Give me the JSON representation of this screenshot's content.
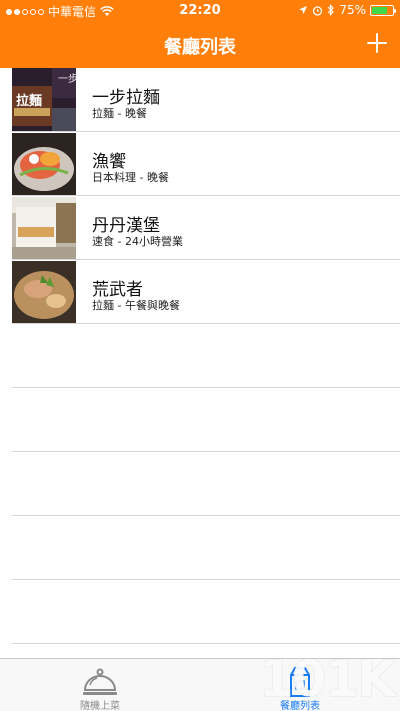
{
  "status_bar": {
    "carrier": "中華電信",
    "time": "22:20",
    "battery": "75%",
    "battery_level": 0.75,
    "signal_bars_filled": 2,
    "signal_bars_total": 5
  },
  "nav": {
    "title": "餐廳列表",
    "add_icon": "plus-icon"
  },
  "restaurants": [
    {
      "name": "一步拉麵",
      "meta": "拉麵 - 晚餐",
      "thumb_text": "拉麵"
    },
    {
      "name": "漁饗",
      "meta": "日本料理 - 晚餐"
    },
    {
      "name": "丹丹漢堡",
      "meta": "速食 - 24小時營業"
    },
    {
      "name": "荒武者",
      "meta": "拉麵 - 午餐與晚餐"
    }
  ],
  "tabs": [
    {
      "label": "隨機上菜",
      "icon": "cloche-icon",
      "selected": false
    },
    {
      "label": "餐廳列表",
      "icon": "milk-carton-icon",
      "selected": true
    }
  ],
  "colors": {
    "nav_background": "#ff7f0a",
    "tab_selected": "#1a7cf6",
    "tab_unselected": "#8a8a8a",
    "battery_fill": "#41d94a"
  },
  "watermark": "101K"
}
